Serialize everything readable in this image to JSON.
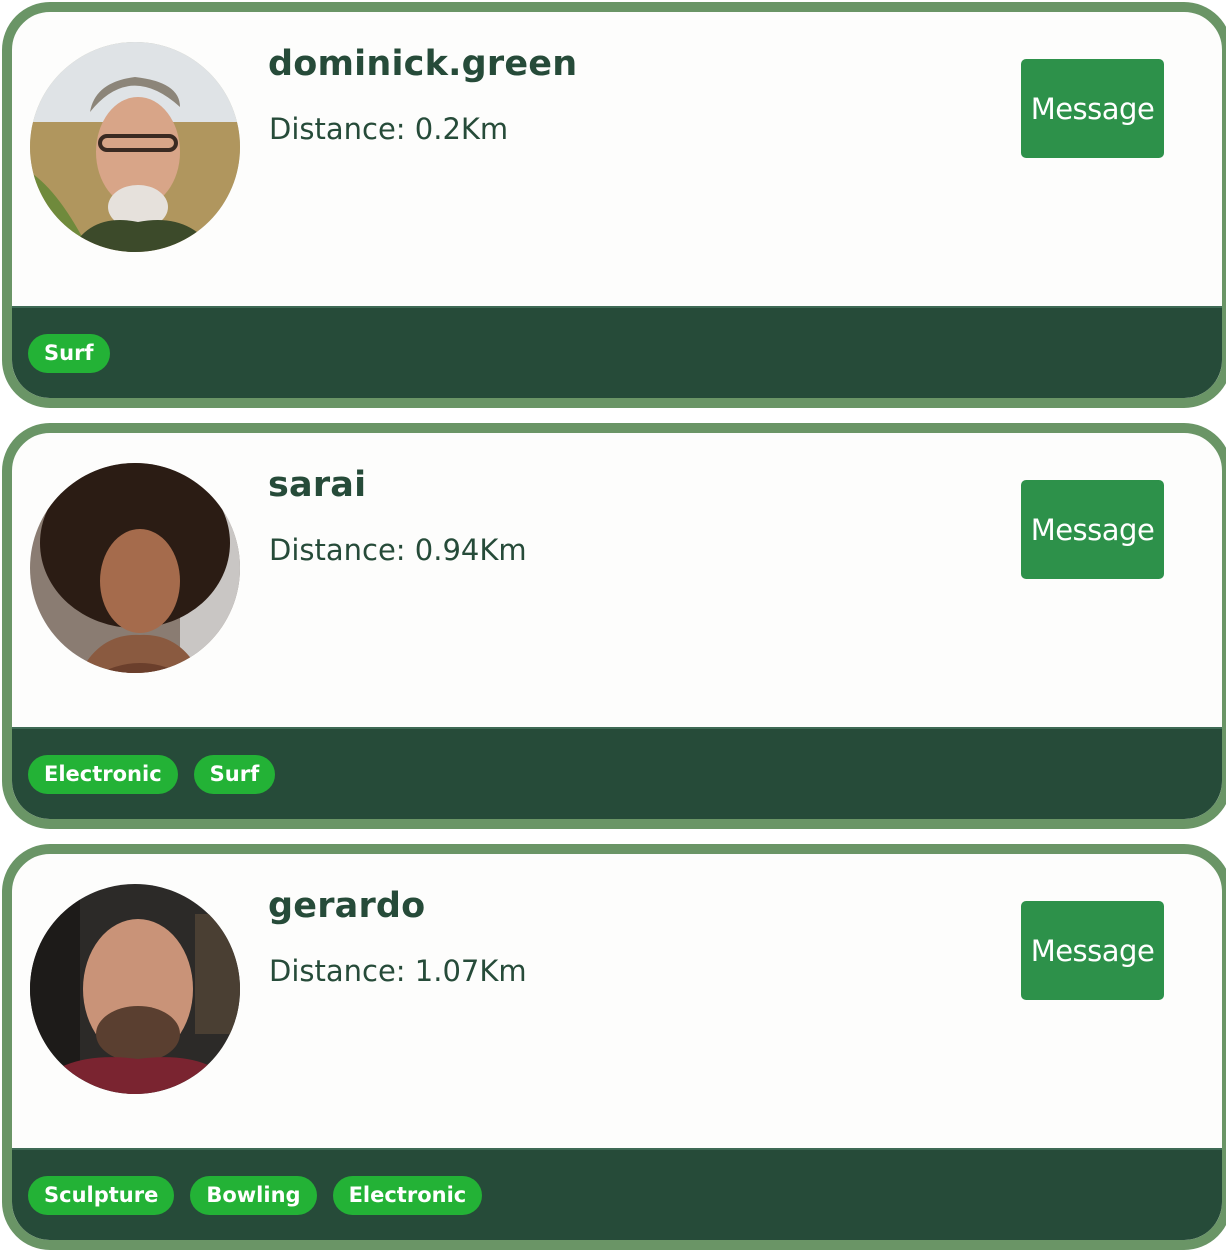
{
  "users": [
    {
      "username": "dominick.green",
      "distance_label": "Distance:",
      "distance_value": "0.2Km",
      "message_label": "Message",
      "tags": [
        "Surf"
      ]
    },
    {
      "username": "sarai",
      "distance_label": "Distance:",
      "distance_value": "0.94Km",
      "message_label": "Message",
      "tags": [
        "Electronic",
        "Surf"
      ]
    },
    {
      "username": "gerardo",
      "distance_label": "Distance:",
      "distance_value": "1.07Km",
      "message_label": "Message",
      "tags": [
        "Sculpture",
        "Bowling",
        "Electronic"
      ]
    }
  ],
  "colors": {
    "card_border": "#6a9566",
    "footer_bg": "#264b39",
    "text_dark": "#264b39",
    "button_bg": "#2d914a",
    "tag_bg": "#23b236"
  },
  "icons": {
    "avatar": "user-avatar-photo"
  }
}
